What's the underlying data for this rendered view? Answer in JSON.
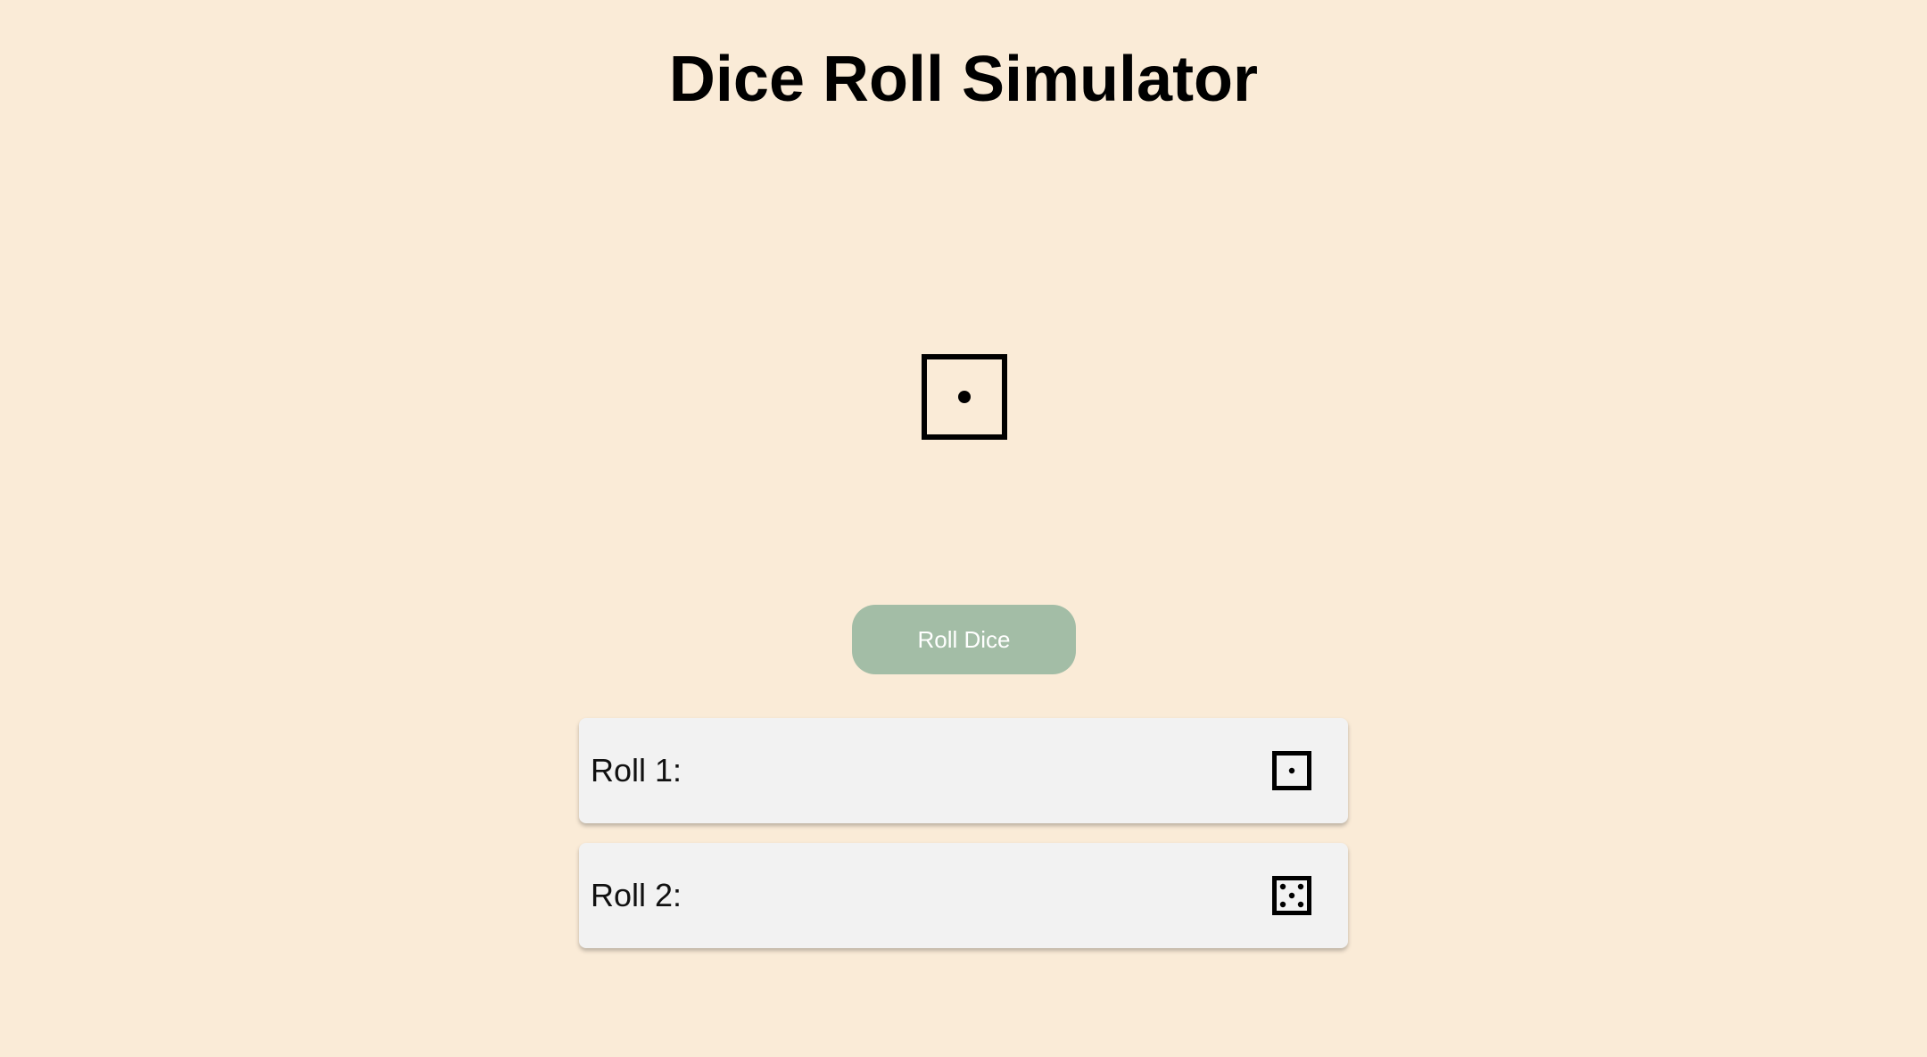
{
  "app": {
    "title": "Dice Roll Simulator"
  },
  "current_roll": {
    "value": 1,
    "icon": "die-face-1-icon"
  },
  "controls": {
    "roll_label": "Roll Dice"
  },
  "history": [
    {
      "label": "Roll 1:",
      "value": 1,
      "icon": "die-face-1-icon"
    },
    {
      "label": "Roll 2:",
      "value": 5,
      "icon": "die-face-5-icon"
    }
  ],
  "colors": {
    "background": "#faebd7",
    "button": "#a3bda6",
    "button_text": "#ffffff",
    "card": "#f2f2f2"
  }
}
